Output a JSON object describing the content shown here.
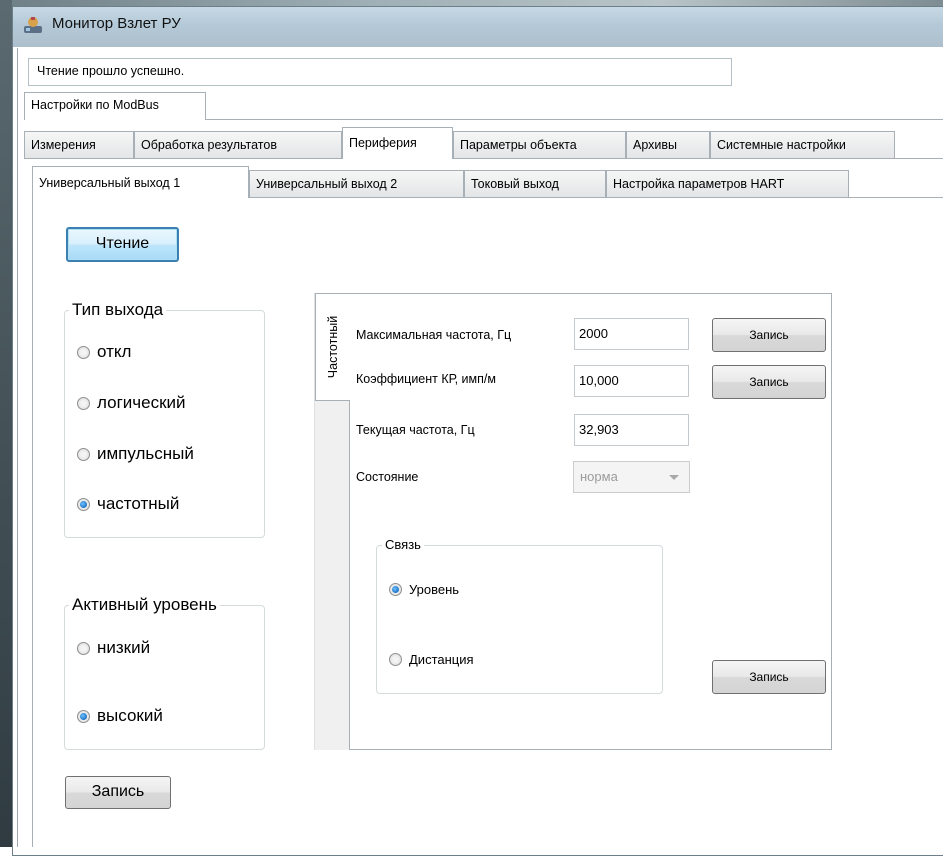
{
  "window": {
    "title": "Монитор Взлет РУ",
    "icon": "app-icon"
  },
  "status": {
    "message": "Чтение прошло успешно."
  },
  "top_tab": {
    "label": "Настройки по ModBus"
  },
  "main_tabs": [
    {
      "label": "Измерения",
      "active": false
    },
    {
      "label": "Обработка результатов",
      "active": false
    },
    {
      "label": "Периферия",
      "active": true
    },
    {
      "label": "Параметры объекта",
      "active": false
    },
    {
      "label": "Архивы",
      "active": false
    },
    {
      "label": "Системные настройки",
      "active": false
    }
  ],
  "sub_tabs": [
    {
      "label": "Универсальный выход 1",
      "active": true
    },
    {
      "label": "Универсальный выход 2",
      "active": false
    },
    {
      "label": "Токовый выход",
      "active": false
    },
    {
      "label": "Настройка параметров HART",
      "active": false
    }
  ],
  "read_button": {
    "label": "Чтение"
  },
  "output_type": {
    "title": "Тип выхода",
    "options": [
      {
        "label": "откл",
        "checked": false
      },
      {
        "label": "логический",
        "checked": false
      },
      {
        "label": "импульсный",
        "checked": false
      },
      {
        "label": "частотный",
        "checked": true
      }
    ]
  },
  "active_level": {
    "title": "Активный уровень",
    "options": [
      {
        "label": "низкий",
        "checked": false
      },
      {
        "label": "высокий",
        "checked": true
      }
    ]
  },
  "write_button_main": {
    "label": "Запись"
  },
  "freq_tab": {
    "side_label": "Частотный",
    "max_freq": {
      "label": "Максимальная частота, Гц",
      "value": "2000",
      "write_label": "Запись"
    },
    "coeff": {
      "label": "Коэффициент КР, имп/м",
      "value": "10,000",
      "write_label": "Запись"
    },
    "current_freq": {
      "label": "Текущая частота, Гц",
      "value": "32,903"
    },
    "state": {
      "label": "Состояние",
      "value": "норма"
    },
    "link": {
      "title": "Связь",
      "options": [
        {
          "label": "Уровень",
          "checked": true
        },
        {
          "label": "Дистанция",
          "checked": false
        }
      ]
    },
    "write_label": "Запись"
  }
}
